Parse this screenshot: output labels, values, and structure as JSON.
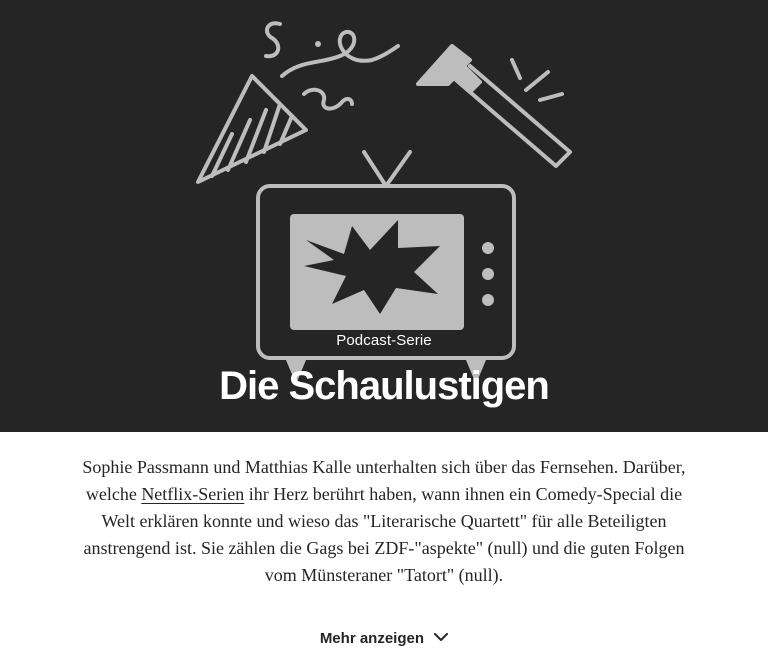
{
  "hero": {
    "kicker": "Podcast-Serie",
    "title": "Die Schaulustigen",
    "background_color": "#252525",
    "illustration_icons": [
      "party-hat-icon",
      "confetti-icon",
      "hammer-icon",
      "tv-icon"
    ]
  },
  "description": {
    "before_link": "Sophie Passmann und Matthias Kalle unterhalten sich über das Fernsehen. Darüber, welche ",
    "link_text": "Netflix-Serien",
    "after_link": " ihr Herz berührt haben, wann ihnen ein Comedy-Special die Welt erklären konnte und wieso das \"Literarische Quartett\" für alle Beteiligten anstrengend ist. Sie zählen die Gags bei ZDF-\"aspekte\" (null) und die guten Folgen vom Münsteraner \"Tatort\" (null)."
  },
  "show_more": {
    "label": "Mehr anzeigen",
    "icon": "chevron-down-icon"
  }
}
